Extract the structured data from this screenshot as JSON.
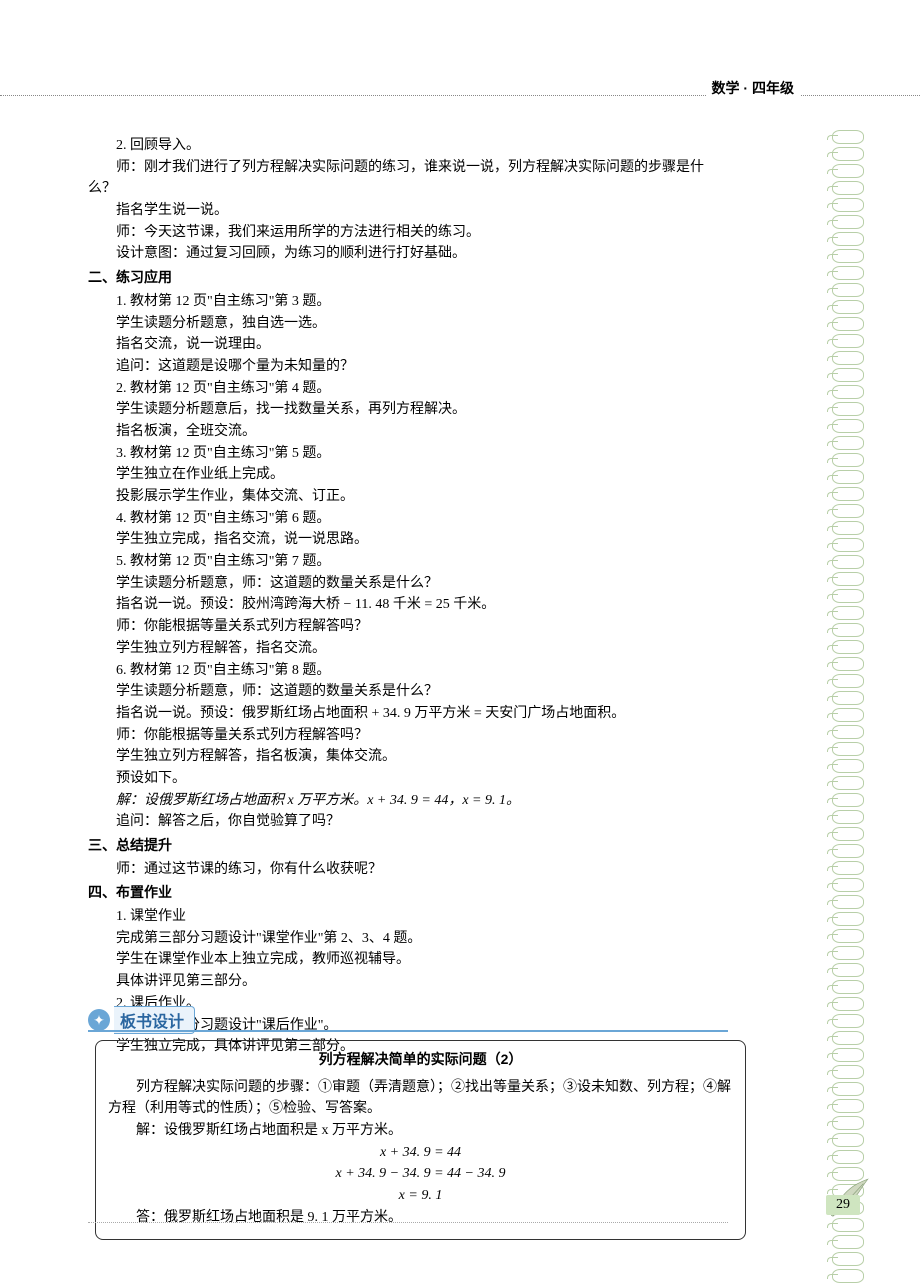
{
  "header": {
    "title": "数学 · 四年级"
  },
  "body": {
    "l1": "2. 回顾导入。",
    "l2": "师：刚才我们进行了列方程解决实际问题的练习，谁来说一说，列方程解决实际问题的步骤是什么？",
    "l3": "指名学生说一说。",
    "l4": "师：今天这节课，我们来运用所学的方法进行相关的练习。",
    "l5": "设计意图：通过复习回顾，为练习的顺利进行打好基础。",
    "s2": "二、练习应用",
    "l6": "1. 教材第 12 页\"自主练习\"第 3 题。",
    "l7": "学生读题分析题意，独自选一选。",
    "l8": "指名交流，说一说理由。",
    "l9": "追问：这道题是设哪个量为未知量的？",
    "l10": "2. 教材第 12 页\"自主练习\"第 4 题。",
    "l11": "学生读题分析题意后，找一找数量关系，再列方程解决。",
    "l12": "指名板演，全班交流。",
    "l13": "3. 教材第 12 页\"自主练习\"第 5 题。",
    "l14": "学生独立在作业纸上完成。",
    "l15": "投影展示学生作业，集体交流、订正。",
    "l16": "4. 教材第 12 页\"自主练习\"第 6 题。",
    "l17": "学生独立完成，指名交流，说一说思路。",
    "l18": "5. 教材第 12 页\"自主练习\"第 7 题。",
    "l19": "学生读题分析题意，师：这道题的数量关系是什么？",
    "l20": "指名说一说。预设：胶州湾跨海大桥 − 11. 48 千米 = 25 千米。",
    "l21": "师：你能根据等量关系式列方程解答吗？",
    "l22": "学生独立列方程解答，指名交流。",
    "l23": "6. 教材第 12 页\"自主练习\"第 8 题。",
    "l24": "学生读题分析题意，师：这道题的数量关系是什么？",
    "l25": "指名说一说。预设：俄罗斯红场占地面积 + 34. 9 万平方米 = 天安门广场占地面积。",
    "l26": "师：你能根据等量关系式列方程解答吗？",
    "l27": "学生独立列方程解答，指名板演，集体交流。",
    "l28": "预设如下。",
    "l29": "解：设俄罗斯红场占地面积 x 万平方米。x + 34. 9 = 44，x = 9. 1。",
    "l30": "追问：解答之后，你自觉验算了吗？",
    "s3": "三、总结提升",
    "l31": "师：通过这节课的练习，你有什么收获呢？",
    "s4": "四、布置作业",
    "l32": "1. 课堂作业",
    "l33": "完成第三部分习题设计\"课堂作业\"第 2、3、4 题。",
    "l34": "学生在课堂作业本上独立完成，教师巡视辅导。",
    "l35": "具体讲评见第三部分。",
    "l36": "2. 课后作业。",
    "l37": "完成第三部分习题设计\"课后作业\"。",
    "l38": "学生独立完成，具体讲评见第三部分。"
  },
  "blackboard": {
    "icon": "✦",
    "label": "板书设计",
    "title": "列方程解决简单的实际问题（2）",
    "p1": "列方程解决实际问题的步骤：①审题（弄清题意）；②找出等量关系；③设未知数、列方程；④解方程（利用等式的性质）；⑤检验、写答案。",
    "p2": "解：设俄罗斯红场占地面积是 x 万平方米。",
    "eq1": "x + 34. 9 = 44",
    "eq2": "x + 34. 9 − 34. 9 = 44 − 34. 9",
    "eq3": "x = 9. 1",
    "ans": "答：俄罗斯红场占地面积是 9. 1 万平方米。"
  },
  "page_number": "29"
}
